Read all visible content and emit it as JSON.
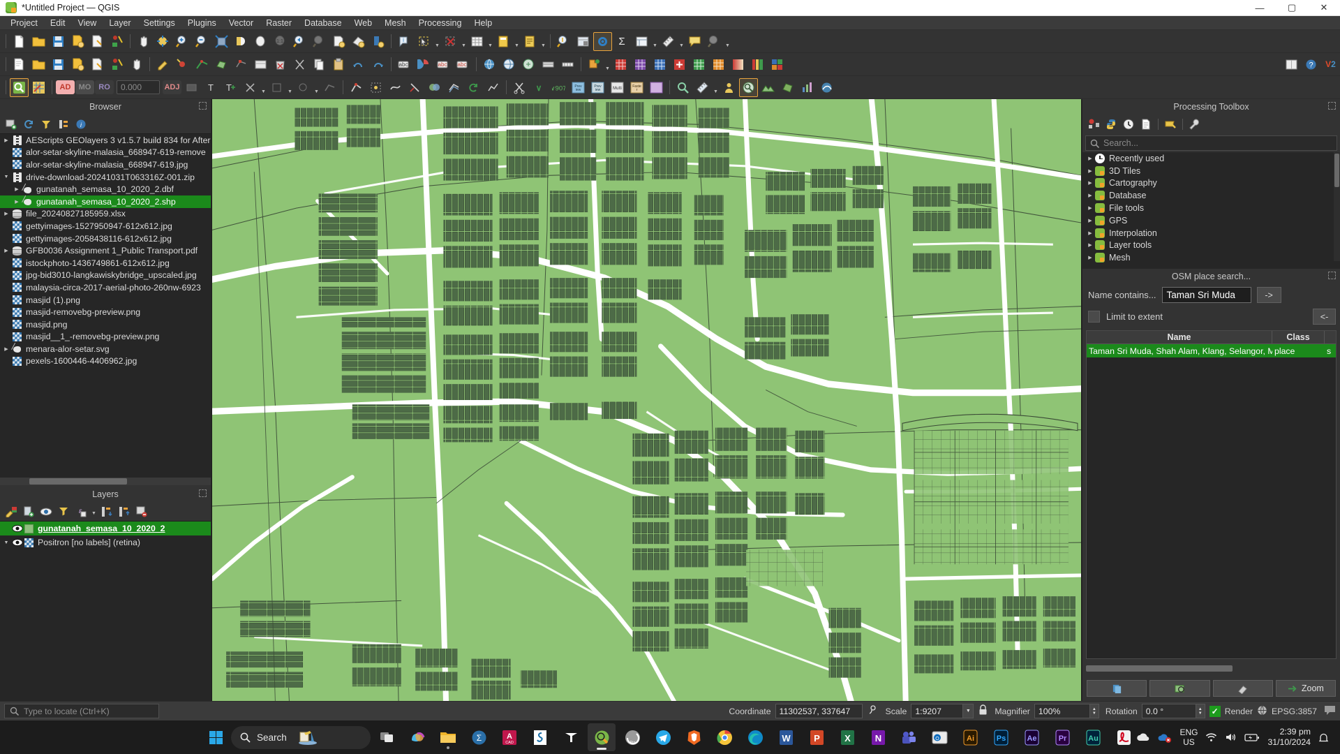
{
  "window": {
    "title": "*Untitled Project — QGIS",
    "app_icon": "qgis-icon",
    "minimize": "—",
    "maximize": "▢",
    "close": "✕"
  },
  "menubar": {
    "items": [
      "Project",
      "Edit",
      "View",
      "Layer",
      "Settings",
      "Plugins",
      "Vector",
      "Raster",
      "Database",
      "Web",
      "Mesh",
      "Processing",
      "Help"
    ]
  },
  "toolbars": {
    "row3_fields": {
      "ad_badge": "AD",
      "mo_badge": "MO",
      "ro_badge": "RO",
      "number_value": "0.000",
      "adj_badge": "ADJ"
    },
    "plugin_badges": [
      "abc",
      "abc",
      "abc"
    ],
    "vector_badge": "V",
    "digit_badge": "2"
  },
  "browser": {
    "title": "Browser",
    "tools": [
      "add-layer-icon",
      "refresh-icon",
      "filter-icon",
      "collapse-all-icon",
      "properties-icon"
    ],
    "items": [
      {
        "label": "AEScripts GEOlayers 3 v1.5.7 build 834 for After",
        "icon": "zip-icon",
        "expandable": true,
        "indent": 0,
        "selected": false
      },
      {
        "label": "alor-setar-skyline-malasia_668947-619-remove",
        "icon": "raster-icon",
        "expandable": false,
        "indent": 0,
        "selected": false
      },
      {
        "label": "alor-setar-skyline-malasia_668947-619.jpg",
        "icon": "raster-icon",
        "expandable": false,
        "indent": 0,
        "selected": false
      },
      {
        "label": "drive-download-20241031T063316Z-001.zip",
        "icon": "zip-icon",
        "expandable": true,
        "expanded": true,
        "indent": 0,
        "selected": false
      },
      {
        "label": "gunatanah_semasa_10_2020_2.dbf",
        "icon": "shp-icon",
        "expandable": true,
        "indent": 1,
        "selected": false
      },
      {
        "label": "gunatanah_semasa_10_2020_2.shp",
        "icon": "shp-icon",
        "expandable": true,
        "indent": 1,
        "selected": true
      },
      {
        "label": "file_20240827185959.xlsx",
        "icon": "db-icon",
        "expandable": true,
        "indent": 0,
        "selected": false
      },
      {
        "label": "gettyimages-1527950947-612x612.jpg",
        "icon": "raster-icon",
        "expandable": false,
        "indent": 0,
        "selected": false
      },
      {
        "label": "gettyimages-2058438116-612x612.jpg",
        "icon": "raster-icon",
        "expandable": false,
        "indent": 0,
        "selected": false
      },
      {
        "label": "GFB0036 Assignment 1_Public Transport.pdf",
        "icon": "db-icon",
        "expandable": true,
        "indent": 0,
        "selected": false
      },
      {
        "label": "istockphoto-1436749861-612x612.jpg",
        "icon": "raster-icon",
        "expandable": false,
        "indent": 0,
        "selected": false
      },
      {
        "label": "jpg-bid3010-langkawiskybridge_upscaled.jpg",
        "icon": "raster-icon",
        "expandable": false,
        "indent": 0,
        "selected": false
      },
      {
        "label": "malaysia-circa-2017-aerial-photo-260nw-6923",
        "icon": "raster-icon",
        "expandable": false,
        "indent": 0,
        "selected": false
      },
      {
        "label": "masjid (1).png",
        "icon": "raster-icon",
        "expandable": false,
        "indent": 0,
        "selected": false
      },
      {
        "label": "masjid-removebg-preview.png",
        "icon": "raster-icon",
        "expandable": false,
        "indent": 0,
        "selected": false
      },
      {
        "label": "masjid.png",
        "icon": "raster-icon",
        "expandable": false,
        "indent": 0,
        "selected": false
      },
      {
        "label": "masjid__1_-removebg-preview.png",
        "icon": "raster-icon",
        "expandable": false,
        "indent": 0,
        "selected": false
      },
      {
        "label": "menara-alor-setar.svg",
        "icon": "shp-icon",
        "expandable": true,
        "indent": 0,
        "selected": false
      },
      {
        "label": "pexels-1600446-4406962.jpg",
        "icon": "raster-icon",
        "expandable": false,
        "indent": 0,
        "selected": false
      }
    ]
  },
  "layers": {
    "title": "Layers",
    "tools": [
      "style-manager-icon",
      "add-group-icon",
      "show-all-icon",
      "filter-legend-icon",
      "expression-filter-icon",
      "expand-all-icon",
      "collapse-all-icon",
      "remove-layer-icon"
    ],
    "items": [
      {
        "label": "gunatanah_semasa_10_2020_2",
        "visible": true,
        "selected": true,
        "symbol": "polygon-swatch",
        "expandable": false
      },
      {
        "label": "Positron [no labels] (retina)",
        "visible": true,
        "selected": false,
        "symbol": "raster-icon",
        "expandable": true
      }
    ]
  },
  "processing_toolbox": {
    "title": "Processing Toolbox",
    "tools": [
      "models-icon",
      "python-icon",
      "history-icon",
      "results-icon",
      "edit-features-icon",
      "options-icon"
    ],
    "search_placeholder": "Search...",
    "search_value": "",
    "groups": [
      {
        "label": "Recently used",
        "icon": "clock-icon"
      },
      {
        "label": "3D Tiles",
        "icon": "qgis-icon"
      },
      {
        "label": "Cartography",
        "icon": "qgis-icon"
      },
      {
        "label": "Database",
        "icon": "qgis-icon"
      },
      {
        "label": "File tools",
        "icon": "qgis-icon"
      },
      {
        "label": "GPS",
        "icon": "qgis-icon"
      },
      {
        "label": "Interpolation",
        "icon": "qgis-icon"
      },
      {
        "label": "Layer tools",
        "icon": "qgis-icon"
      },
      {
        "label": "Mesh",
        "icon": "qgis-icon"
      }
    ]
  },
  "osm_search": {
    "title": "OSM place search...",
    "name_label": "Name contains...",
    "name_value": "Taman Sri Muda",
    "name_placeholder": "",
    "go_button": "->",
    "back_button": "<-",
    "limit_checkbox_label": "Limit to extent",
    "limit_checked": false,
    "columns": [
      "Name",
      "Class",
      "S"
    ],
    "results": [
      {
        "name": "Taman Sri Muda, Shah Alam, Klang, Selangor, Malaysia",
        "class": "place",
        "s": "s",
        "selected": true
      }
    ],
    "buttons": [
      "copy-button",
      "zoom-selection-button",
      "clear-button",
      "Zoom"
    ],
    "zoom_label": "Zoom"
  },
  "statusbar": {
    "locator_placeholder": "Type to locate (Ctrl+K)",
    "locator_value": "",
    "coordinate_label": "Coordinate",
    "coordinate_value": "11302537, 337647",
    "scale_label": "Scale",
    "scale_value": "1:9207",
    "magnifier_label": "Magnifier",
    "magnifier_value": "100%",
    "rotation_label": "Rotation",
    "rotation_value": "0.0 °",
    "render_label": "Render",
    "render_checked": true,
    "crs_label": "EPSG:3857",
    "lock_icon": "lock-icon",
    "messages_icon": "messages-icon"
  },
  "taskbar": {
    "start_label": "start-button",
    "search_placeholder": "Search",
    "apps": [
      {
        "name": "task-view",
        "active": false
      },
      {
        "name": "copilot",
        "active": false
      },
      {
        "name": "file-explorer",
        "active": false,
        "running": true
      },
      {
        "name": "mendeley",
        "active": false
      },
      {
        "name": "autocad",
        "active": false
      },
      {
        "name": "scribd",
        "active": false
      },
      {
        "name": "tiktok",
        "active": false
      },
      {
        "name": "qgis",
        "active": true
      },
      {
        "name": "grammarly",
        "active": false
      },
      {
        "name": "telegram",
        "active": false
      },
      {
        "name": "brave",
        "active": false
      },
      {
        "name": "chrome",
        "active": false
      },
      {
        "name": "edge",
        "active": false
      },
      {
        "name": "word",
        "active": false
      },
      {
        "name": "powerpoint",
        "active": false
      },
      {
        "name": "excel",
        "active": false
      },
      {
        "name": "onenote",
        "active": false
      },
      {
        "name": "teams",
        "active": false
      },
      {
        "name": "outlook",
        "active": false
      },
      {
        "name": "illustrator",
        "active": false
      },
      {
        "name": "photoshop",
        "active": false
      },
      {
        "name": "aftereffects",
        "active": false
      },
      {
        "name": "premiere",
        "active": false
      },
      {
        "name": "audition",
        "active": false
      },
      {
        "name": "acrobat",
        "active": false
      }
    ],
    "tray": {
      "overflow": "^",
      "onedrive": "onedrive-icon",
      "cloud_error": "cloud-error-icon",
      "language_line1": "ENG",
      "language_line2": "US",
      "wifi": "wifi-icon",
      "volume": "volume-icon",
      "battery": "battery-charging-icon",
      "time": "2:39 pm",
      "date": "31/10/2024",
      "notifications": "bell-icon"
    }
  },
  "map": {
    "background_color": "#8fc475",
    "parcel_fill": "#8fc475",
    "building_fill": "#4d6b47",
    "road_color": "#ffffff",
    "outline_color": "#333333"
  }
}
